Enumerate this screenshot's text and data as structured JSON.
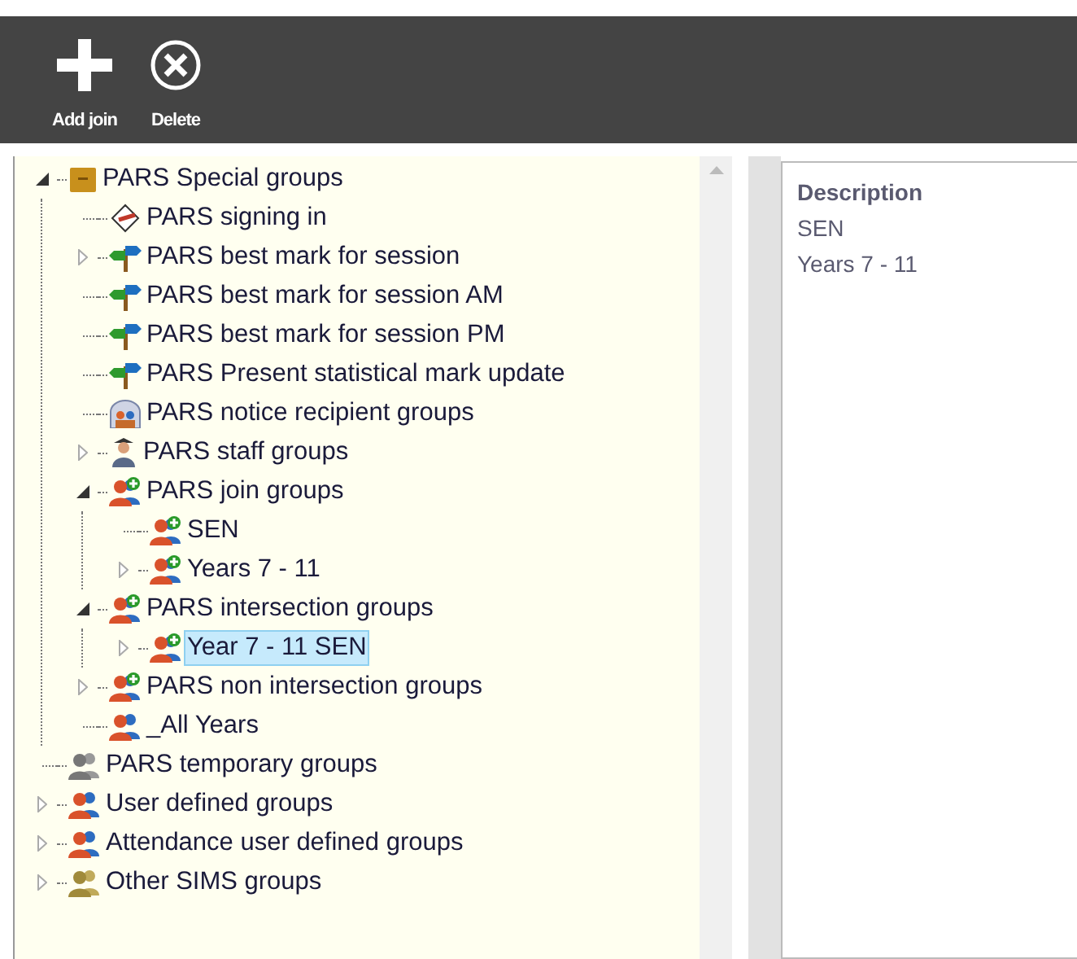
{
  "toolbar": [
    {
      "label": "Add join",
      "kind": "add"
    },
    {
      "label": "Delete",
      "kind": "delete"
    }
  ],
  "tree": [
    {
      "label": "PARS Special groups",
      "kind": "folder",
      "expanded": true,
      "selected": false,
      "children": [
        {
          "label": "PARS signing in",
          "kind": "signing",
          "selected": false
        },
        {
          "label": "PARS best mark for session",
          "kind": "signpost",
          "expanded": false,
          "selected": false
        },
        {
          "label": "PARS best mark for session AM",
          "kind": "signpost",
          "selected": false
        },
        {
          "label": "PARS best mark for session PM",
          "kind": "signpost",
          "selected": false
        },
        {
          "label": "PARS Present statistical mark update",
          "kind": "signpost",
          "selected": false
        },
        {
          "label": "PARS notice recipient groups",
          "kind": "notice",
          "selected": false
        },
        {
          "label": "PARS staff groups",
          "kind": "staff",
          "expanded": false,
          "selected": false
        },
        {
          "label": "PARS join groups",
          "kind": "join",
          "expanded": true,
          "selected": false,
          "children": [
            {
              "label": "SEN",
              "kind": "join",
              "selected": false
            },
            {
              "label": "Years 7 - 11",
              "kind": "join",
              "expanded": false,
              "selected": false
            }
          ]
        },
        {
          "label": "PARS intersection groups",
          "kind": "join",
          "expanded": true,
          "selected": false,
          "children": [
            {
              "label": "Year 7 - 11 SEN",
              "kind": "join",
              "expanded": false,
              "selected": true
            }
          ]
        },
        {
          "label": "PARS non intersection groups",
          "kind": "join",
          "expanded": false,
          "selected": false
        },
        {
          "label": "_All Years",
          "kind": "group",
          "selected": false
        }
      ]
    },
    {
      "label": "PARS temporary groups",
      "kind": "temporary",
      "selected": false
    },
    {
      "label": "User defined groups",
      "kind": "group",
      "expanded": false,
      "selected": false
    },
    {
      "label": "Attendance user defined groups",
      "kind": "group",
      "expanded": false,
      "selected": false
    },
    {
      "label": "Other SIMS groups",
      "kind": "other",
      "expanded": false,
      "selected": false
    }
  ],
  "detail": {
    "heading": "Description",
    "lines": [
      "SEN",
      "Years 7 - 11"
    ]
  }
}
